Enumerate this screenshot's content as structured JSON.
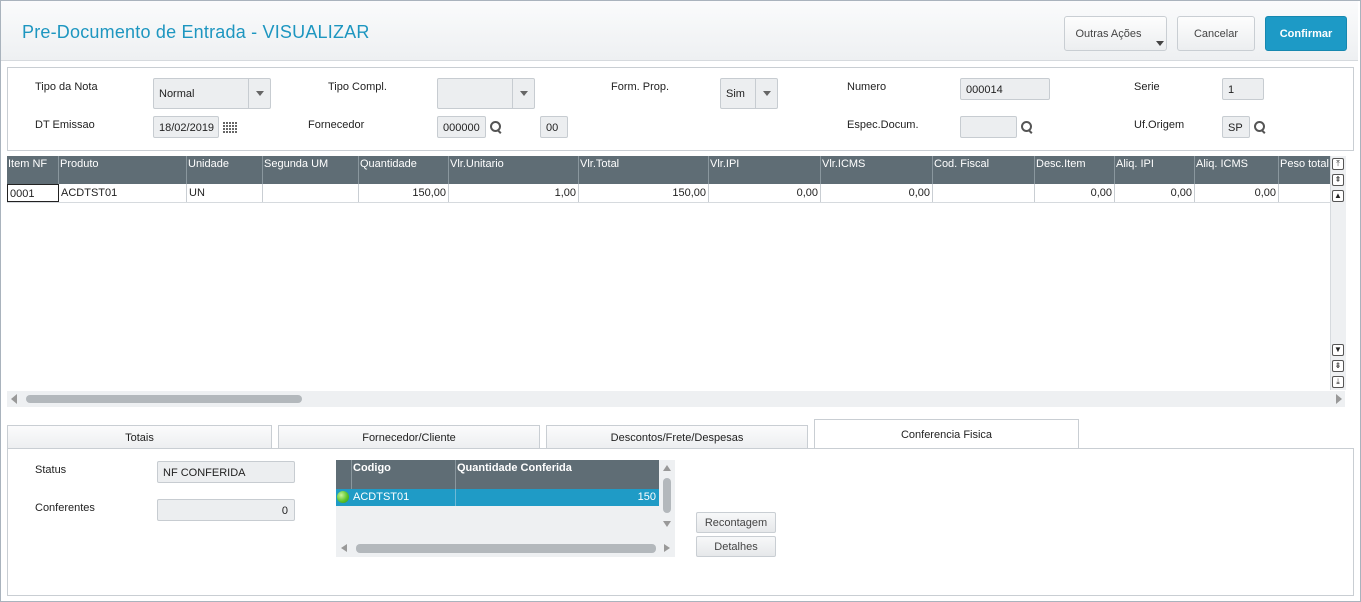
{
  "header": {
    "title": "Pre-Documento de Entrada - VISUALIZAR",
    "other_actions_label": "Outras Ações",
    "cancel_label": "Cancelar",
    "confirm_label": "Confirmar"
  },
  "form": {
    "tipo_nota": {
      "label": "Tipo da Nota",
      "value": "Normal"
    },
    "tipo_compl": {
      "label": "Tipo Compl.",
      "value": ""
    },
    "form_prop": {
      "label": "Form. Prop.",
      "value": "Sim"
    },
    "numero": {
      "label": "Numero",
      "value": "000014"
    },
    "serie": {
      "label": "Serie",
      "value": "1"
    },
    "dt_emissao": {
      "label": "DT Emissao",
      "value": "18/02/2019"
    },
    "fornecedor": {
      "label": "Fornecedor",
      "value": "000000",
      "loja": "00"
    },
    "espec_docum": {
      "label": "Espec.Docum.",
      "value": ""
    },
    "uf_origem": {
      "label": "Uf.Origem",
      "value": "SP"
    }
  },
  "items_grid": {
    "columns": [
      "Item NF",
      "Produto",
      "Unidade",
      "Segunda UM",
      "Quantidade",
      "Vlr.Unitario",
      "Vlr.Total",
      "Vlr.IPI",
      "Vlr.ICMS",
      "Cod. Fiscal",
      "Desc.Item",
      "Aliq. IPI",
      "Aliq. ICMS",
      "Peso total"
    ],
    "rows": [
      [
        "0001",
        "ACDTST01",
        "UN",
        "",
        "150,00",
        "1,00",
        "150,00",
        "0,00",
        "0,00",
        "",
        "0,00",
        "0,00",
        "0,00",
        ""
      ]
    ]
  },
  "tabs": [
    "Totais",
    "Fornecedor/Cliente",
    "Descontos/Frete/Despesas",
    "Conferencia Fisica"
  ],
  "active_tab": "Conferencia Fisica",
  "conferencia": {
    "status_label": "Status",
    "status_value": "NF CONFERIDA",
    "conferentes_label": "Conferentes",
    "conferentes_value": "0",
    "grid_columns": [
      "Codigo",
      "Quantidade Conferida"
    ],
    "grid_rows": [
      {
        "status_icon": "green-circle-icon",
        "codigo": "ACDTST01",
        "quantidade": "150"
      }
    ],
    "recontagem_label": "Recontagem",
    "detalhes_label": "Detalhes"
  },
  "colors": {
    "accent": "#1d96c0",
    "confirm_button": "#1d9ac6",
    "grid_header": "#5f6d75",
    "selected_row": "#1f9bc6",
    "status_ok": "#5cc52a"
  }
}
